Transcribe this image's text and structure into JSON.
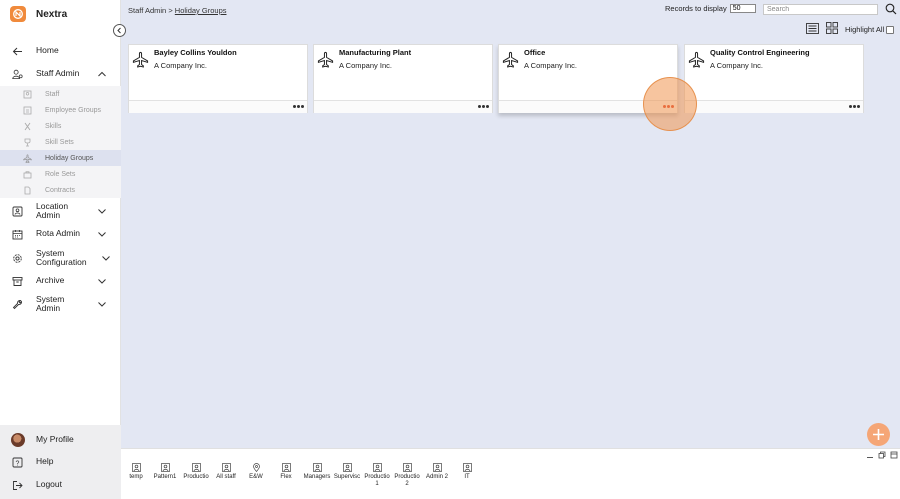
{
  "app": {
    "name": "Nextra"
  },
  "sidebar": {
    "items": [
      {
        "key": "home",
        "label": "Home"
      },
      {
        "key": "staff_admin",
        "label": "Staff Admin"
      },
      {
        "key": "location_admin",
        "label": "Location Admin"
      },
      {
        "key": "rota_admin",
        "label": "Rota Admin"
      },
      {
        "key": "system_configuration",
        "label": "System Configuration"
      },
      {
        "key": "archive",
        "label": "Archive"
      },
      {
        "key": "system_admin",
        "label": "System Admin"
      }
    ],
    "sub_items": [
      {
        "label": "Staff",
        "icon": "people-icon"
      },
      {
        "label": "Employee Groups",
        "icon": "group-icon"
      },
      {
        "label": "Skills",
        "icon": "skills-icon"
      },
      {
        "label": "Skill Sets",
        "icon": "trophy-icon"
      },
      {
        "label": "Holiday Groups",
        "icon": "plane-icon",
        "active": true
      },
      {
        "label": "Role Sets",
        "icon": "briefcase-icon"
      },
      {
        "label": "Contracts",
        "icon": "document-icon"
      }
    ],
    "bottom": {
      "profile": "My Profile",
      "help": "Help",
      "logout": "Logout"
    }
  },
  "header": {
    "breadcrumb_parent": "Staff Admin",
    "breadcrumb_separator": ">",
    "breadcrumb_current": "Holiday Groups",
    "records_label": "Records to display",
    "records_value": "50",
    "search_placeholder": "Search",
    "highlight_label": "Highlight All"
  },
  "cards": [
    {
      "title": "Bayley Collins Youldon",
      "company": "A Company Inc."
    },
    {
      "title": "Manufacturing Plant",
      "company": "A Company Inc."
    },
    {
      "title": "Office",
      "company": "A Company Inc."
    },
    {
      "title": "Quality Control Engineering",
      "company": "A Company Inc."
    }
  ],
  "bottom_groups": [
    {
      "label": "temp",
      "icon": "person-icon"
    },
    {
      "label": "Pattern1",
      "icon": "person-icon"
    },
    {
      "label": "Productio",
      "icon": "person-icon"
    },
    {
      "label": "All staff",
      "icon": "person-icon"
    },
    {
      "label": "E&W",
      "icon": "location-pin-icon"
    },
    {
      "label": "Flex",
      "icon": "person-icon"
    },
    {
      "label": "Managers",
      "icon": "person-icon"
    },
    {
      "label": "Supervisc",
      "icon": "person-icon"
    },
    {
      "label": "Productio 1",
      "icon": "person-icon"
    },
    {
      "label": "Productio 2",
      "icon": "person-icon"
    },
    {
      "label": "Admin 2",
      "icon": "person-icon"
    },
    {
      "label": "IT",
      "icon": "person-icon"
    }
  ],
  "colors": {
    "accent": "#f08a3c",
    "sidebar_active": "#dde1ef",
    "background": "#e3e7f3"
  }
}
